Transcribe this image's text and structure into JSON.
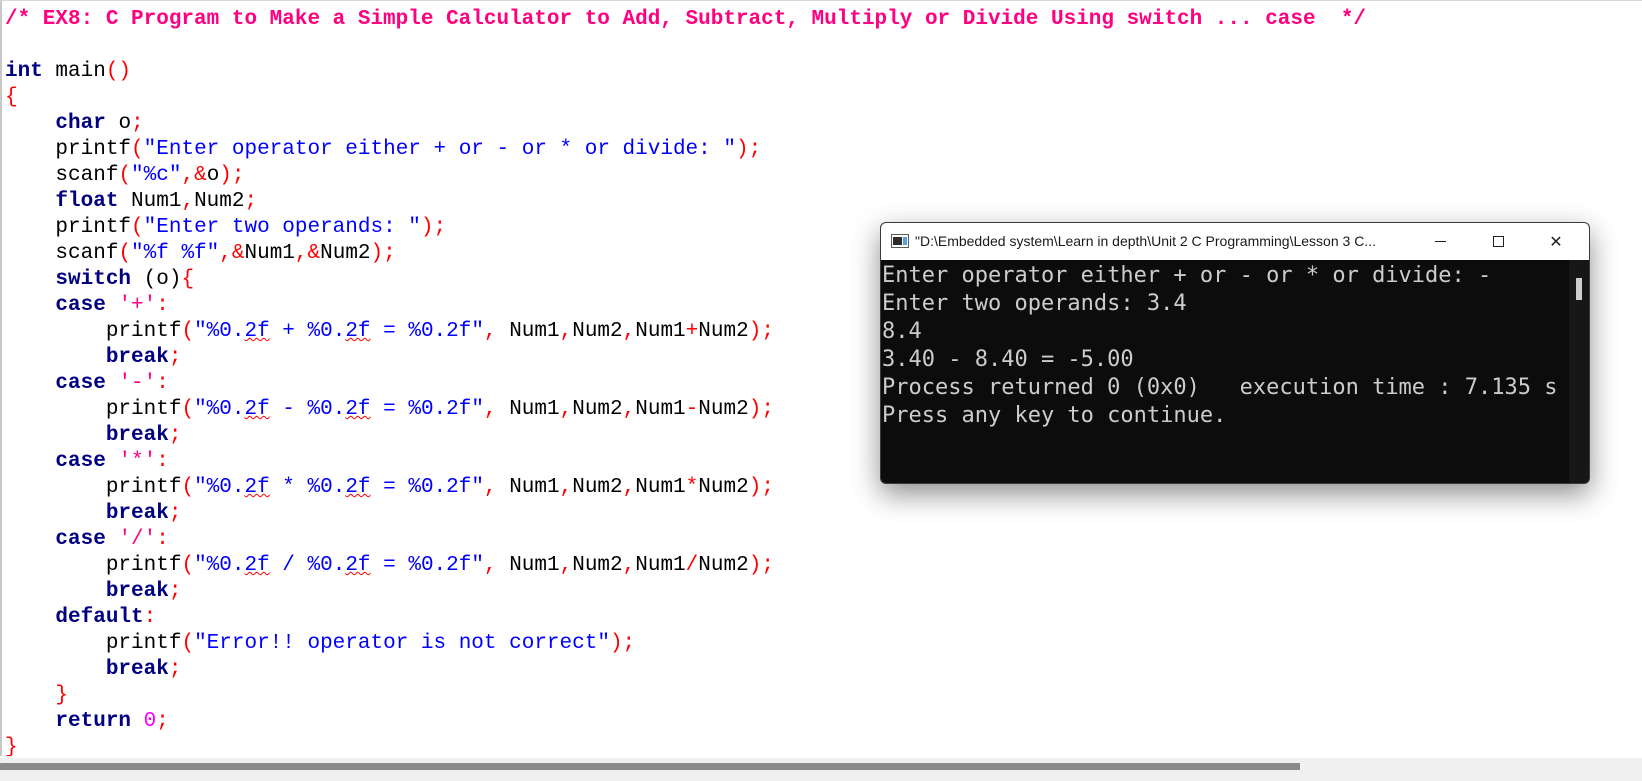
{
  "editor": {
    "header_comment": "/* EX8: C Program to Make a Simple Calculator to Add, Subtract, Multiply or Divide Using switch ... case  */",
    "code": {
      "int": "int",
      "main_sig": " main",
      "paren_open_close": "()",
      "brace_open": "{",
      "brace_close": "}",
      "char_kw": "char",
      "char_decl": " o",
      "semi": ";",
      "printf": "printf",
      "scanf": "scanf",
      "lp": "(",
      "rp": ")",
      "comma": ",",
      "amp": "&",
      "str_prompt_op": "\"Enter operator either + or - or * or divide: \"",
      "str_c_fmt": "\"%c\"",
      "var_o": "o",
      "float_kw": "float",
      "float_decl": " Num1",
      "var_num1": "Num1",
      "var_num2": "Num2",
      "str_prompt_operands": "\"Enter two operands: \"",
      "str_ff_fmt": "\"%f %f\"",
      "switch_kw": "switch",
      "switch_arg": " (o)",
      "case_kw": "case",
      "colon": ":",
      "char_plus": "'+'",
      "char_minus": "'-'",
      "char_star": "'*'",
      "char_slash": "'/'",
      "break_kw": "break",
      "default_kw": "default",
      "return_kw": "return",
      "zero": "0",
      "fmt_pre": "\"%0.",
      "fmt_2f": "2f",
      "fmt_add_mid": " + %0.",
      "fmt_sub_mid": " - %0.",
      "fmt_mul_mid": " * %0.",
      "fmt_div_mid": " / %0.",
      "fmt_tail": " = %0.2f\"",
      "plus": "+",
      "minus": "-",
      "star": "*",
      "slash": "/",
      "str_error": "\"Error!! operator is not correct\""
    }
  },
  "console": {
    "title": "\"D:\\Embedded system\\Learn in depth\\Unit 2 C Programming\\Lesson 3 C...",
    "lines": [
      "Enter operator either + or - or * or divide: -",
      "Enter two operands: 3.4",
      "8.4",
      "3.40 - 8.40 = -5.00",
      "Process returned 0 (0x0)   execution time : 7.135 s",
      "Press any key to continue."
    ]
  }
}
